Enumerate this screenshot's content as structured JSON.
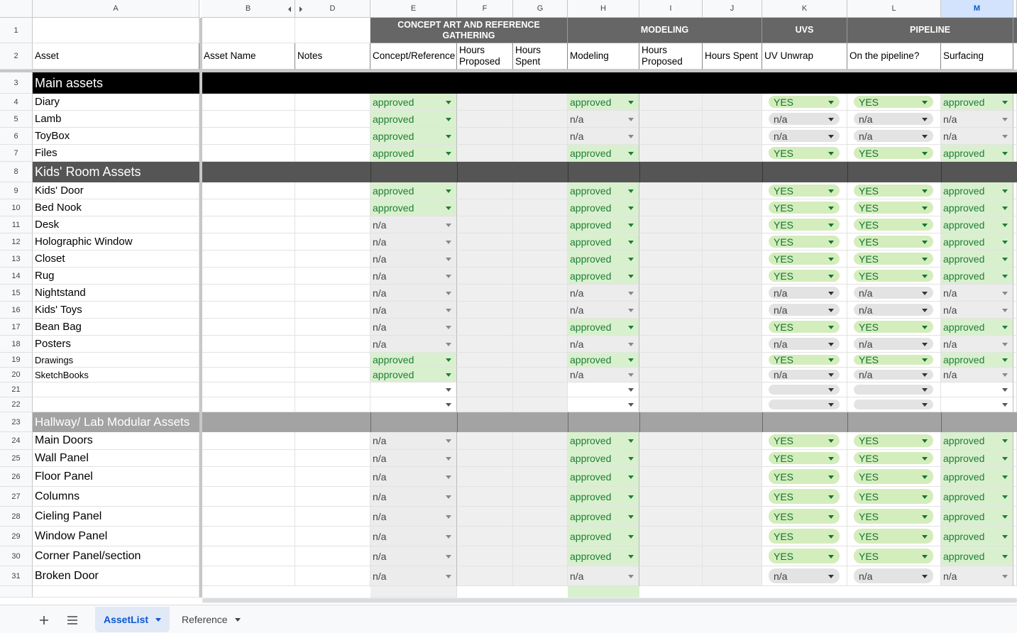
{
  "columns": [
    "A",
    "B",
    "D",
    "E",
    "F",
    "G",
    "H",
    "I",
    "J",
    "K",
    "L",
    "M"
  ],
  "selected_column": "M",
  "groups": [
    {
      "label": "CONCEPT ART AND REFERENCE GATHERING"
    },
    {
      "label": "MODELING"
    },
    {
      "label": "UVS"
    },
    {
      "label": "PIPELINE"
    }
  ],
  "headers": {
    "A": "Asset",
    "B": "Asset Name",
    "D": "Notes",
    "E": "Concept/Reference",
    "F": "Hours Proposed",
    "G": "Hours Spent",
    "H": "Modeling",
    "I": "Hours Proposed",
    "J": "Hours Spent",
    "K": "UV Unwrap",
    "L": "On the pipeline?",
    "M": "Surfacing"
  },
  "sections": [
    {
      "row": "3",
      "label": "Main assets"
    },
    {
      "row": "8",
      "label": "Kids' Room Assets"
    },
    {
      "row": "23",
      "label": "Hallway/ Lab Modular Assets"
    }
  ],
  "header_rows": [
    "1",
    "2"
  ],
  "rows": [
    {
      "num": "4",
      "asset": "Diary",
      "concept": "approved",
      "modeling": "approved",
      "uv": "YES",
      "pipeline": "YES",
      "surfacing": "approved"
    },
    {
      "num": "5",
      "asset": "Lamb",
      "concept": "approved",
      "modeling": "n/a",
      "uv": "n/a",
      "pipeline": "n/a",
      "surfacing": "n/a"
    },
    {
      "num": "6",
      "asset": "ToyBox",
      "concept": "approved",
      "modeling": "n/a",
      "uv": "n/a",
      "pipeline": "n/a",
      "surfacing": "n/a"
    },
    {
      "num": "7",
      "asset": "Files",
      "concept": "approved",
      "modeling": "approved",
      "uv": "YES",
      "pipeline": "YES",
      "surfacing": "approved"
    },
    {
      "num": "9",
      "asset": "Kids' Door",
      "concept": "approved",
      "modeling": "approved",
      "uv": "YES",
      "pipeline": "YES",
      "surfacing": "approved"
    },
    {
      "num": "10",
      "asset": "Bed Nook",
      "concept": "approved",
      "modeling": "approved",
      "uv": "YES",
      "pipeline": "YES",
      "surfacing": "approved"
    },
    {
      "num": "11",
      "asset": "Desk",
      "concept": "n/a",
      "modeling": "approved",
      "uv": "YES",
      "pipeline": "YES",
      "surfacing": "approved"
    },
    {
      "num": "12",
      "asset": "Holographic Window",
      "concept": "n/a",
      "modeling": "approved",
      "uv": "YES",
      "pipeline": "YES",
      "surfacing": "approved"
    },
    {
      "num": "13",
      "asset": "Closet",
      "concept": "n/a",
      "modeling": "approved",
      "uv": "YES",
      "pipeline": "YES",
      "surfacing": "approved"
    },
    {
      "num": "14",
      "asset": "Rug",
      "concept": "n/a",
      "modeling": "approved",
      "uv": "YES",
      "pipeline": "YES",
      "surfacing": "approved"
    },
    {
      "num": "15",
      "asset": "Nightstand",
      "concept": "n/a",
      "modeling": "n/a",
      "uv": "n/a",
      "pipeline": "n/a",
      "surfacing": "n/a"
    },
    {
      "num": "16",
      "asset": "Kids' Toys",
      "concept": "n/a",
      "modeling": "n/a",
      "uv": "n/a",
      "pipeline": "n/a",
      "surfacing": "n/a"
    },
    {
      "num": "17",
      "asset": "Bean Bag",
      "concept": "n/a",
      "modeling": "approved",
      "uv": "YES",
      "pipeline": "YES",
      "surfacing": "approved"
    },
    {
      "num": "18",
      "asset": "Posters",
      "concept": "n/a",
      "modeling": "n/a",
      "uv": "n/a",
      "pipeline": "n/a",
      "surfacing": "n/a"
    },
    {
      "num": "19",
      "asset": "Drawings",
      "concept": "approved",
      "modeling": "approved",
      "uv": "YES",
      "pipeline": "YES",
      "surfacing": "approved"
    },
    {
      "num": "20",
      "asset": "SketchBooks",
      "concept": "approved",
      "modeling": "n/a",
      "uv": "n/a",
      "pipeline": "n/a",
      "surfacing": "n/a"
    },
    {
      "num": "21",
      "asset": "",
      "concept": "",
      "modeling": "",
      "uv": "",
      "pipeline": "",
      "surfacing": ""
    },
    {
      "num": "22",
      "asset": "",
      "concept": "",
      "modeling": "",
      "uv": "",
      "pipeline": "",
      "surfacing": ""
    },
    {
      "num": "24",
      "asset": "Main Doors",
      "concept": "n/a",
      "modeling": "approved",
      "uv": "YES",
      "pipeline": "YES",
      "surfacing": "approved"
    },
    {
      "num": "25",
      "asset": "Wall Panel",
      "concept": "n/a",
      "modeling": "approved",
      "uv": "YES",
      "pipeline": "YES",
      "surfacing": "approved"
    },
    {
      "num": "26",
      "asset": "Floor Panel",
      "concept": "n/a",
      "modeling": "approved",
      "uv": "YES",
      "pipeline": "YES",
      "surfacing": "approved"
    },
    {
      "num": "27",
      "asset": "Columns",
      "concept": "n/a",
      "modeling": "approved",
      "uv": "YES",
      "pipeline": "YES",
      "surfacing": "approved"
    },
    {
      "num": "28",
      "asset": "Cieling Panel",
      "concept": "n/a",
      "modeling": "approved",
      "uv": "YES",
      "pipeline": "YES",
      "surfacing": "approved"
    },
    {
      "num": "29",
      "asset": "Window Panel",
      "concept": "n/a",
      "modeling": "approved",
      "uv": "YES",
      "pipeline": "YES",
      "surfacing": "approved"
    },
    {
      "num": "30",
      "asset": "Corner Panel/section",
      "concept": "n/a",
      "modeling": "approved",
      "uv": "YES",
      "pipeline": "YES",
      "surfacing": "approved"
    },
    {
      "num": "31",
      "asset": "Broken Door",
      "concept": "n/a",
      "modeling": "n/a",
      "uv": "n/a",
      "pipeline": "n/a",
      "surfacing": "n/a"
    }
  ],
  "sheet_tabs": [
    {
      "label": "AssetList",
      "active": true
    },
    {
      "label": "Reference",
      "active": false
    }
  ],
  "icons": {
    "add_sheet": "plus-icon",
    "all_sheets": "menu-icon"
  },
  "colors": {
    "approved_bg": "#d9f0cf",
    "approved_text": "#1e7e34",
    "na_bg": "#ececec",
    "group_header": "#666666",
    "main_section": "#000000",
    "kids_section": "#555555",
    "hallway_section": "#a3a3a3"
  }
}
